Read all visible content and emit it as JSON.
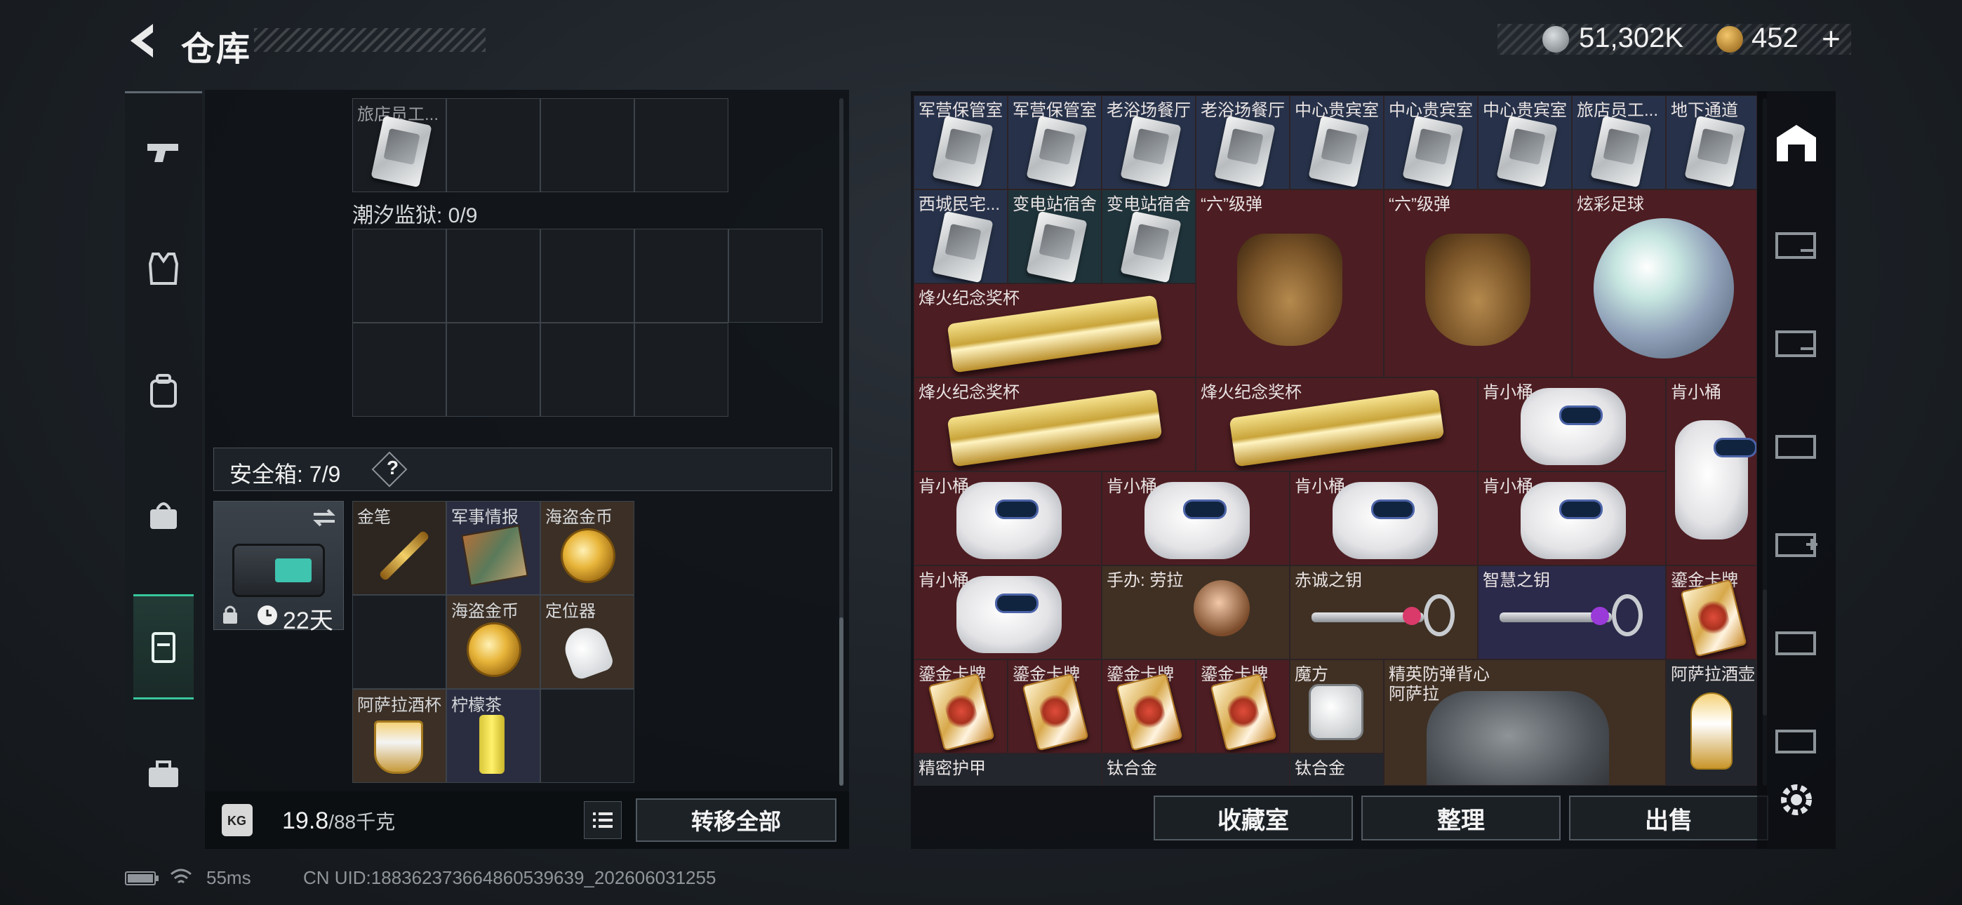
{
  "header": {
    "title": "仓库",
    "currency_silver": "51,302K",
    "currency_gold": "452",
    "plus_label": "+"
  },
  "sidebar": {
    "items": [
      "pistol-icon",
      "armor-vest-icon",
      "backpack-icon",
      "bag-icon",
      "safe-box-icon",
      "toolbox-icon"
    ],
    "active": "safe-box-icon"
  },
  "left": {
    "top_cell_label": "旅店员工...",
    "prison_label": "潮汐监狱: 0/9",
    "safebox_label": "安全箱: 7/9",
    "help_label": "?",
    "safebox_days": "22天",
    "items": [
      {
        "label": "金笔"
      },
      {
        "label": "军事情报"
      },
      {
        "label": "海盗金币"
      },
      {
        "label": "海盗金币"
      },
      {
        "label": "定位器"
      },
      {
        "label": "阿萨拉酒杯"
      },
      {
        "label": "柠檬茶"
      }
    ],
    "weight_value": "19.8",
    "weight_max": "/88千克",
    "weight_fraction": 0.225,
    "transfer_all": "转移全部"
  },
  "right": {
    "row1": [
      "军营保管室",
      "军营保管室",
      "老浴场餐厅",
      "老浴场餐厅",
      "中心贵宾室",
      "中心贵宾室",
      "中心贵宾室",
      "旅店员工...",
      "地下通道"
    ],
    "row2": [
      "西城民宅...",
      "变电站宿舍",
      "变电站宿舍",
      "“六”级弹",
      "“六”级弹",
      "炫彩足球"
    ],
    "row3": [
      "烽火纪念奖杯"
    ],
    "row4": [
      "烽火纪念奖杯",
      "烽火纪念奖杯",
      "肯小桶",
      "肯小桶"
    ],
    "row5": [
      "肯小桶",
      "肯小桶",
      "肯小桶",
      "肯小桶"
    ],
    "row6": [
      "肯小桶",
      "手办: 劳拉",
      "赤诚之钥",
      "智慧之钥",
      "鎏金卡牌"
    ],
    "row7": [
      "鎏金卡牌",
      "鎏金卡牌",
      "鎏金卡牌",
      "鎏金卡牌",
      "魔方",
      "精英防弹背心",
      "阿萨拉",
      "阿萨拉酒壶"
    ],
    "row8": [
      "精密护甲",
      "钛合金",
      "钛合金"
    ],
    "buttons": {
      "collection": "收藏室",
      "organize": "整理",
      "sell": "出售"
    }
  },
  "footer": {
    "ping": "55ms",
    "uid": "CN UID:18836237366486053963​9_202606031255"
  }
}
